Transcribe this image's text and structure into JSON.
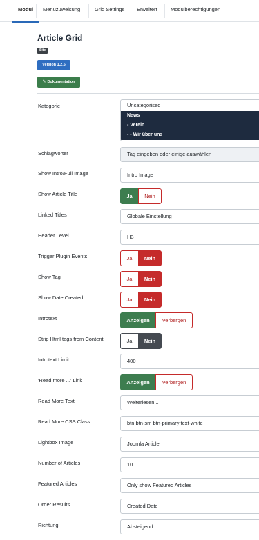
{
  "tabs": [
    "Modul",
    "Menüzuweisung",
    "Grid Settings",
    "Erweitert",
    "Modulberechtigungen"
  ],
  "header": {
    "title": "Article Grid",
    "site_badge": "Site",
    "version_button": "Version 1.2.6",
    "doc_button": "Dokumentation",
    "doc_icon": "edit-icon"
  },
  "category": {
    "label": "Kategorie",
    "top": "Uncategorised",
    "options": [
      "News",
      "- Verein",
      "- - Wir über uns"
    ]
  },
  "tags": {
    "label": "Schlagwörter",
    "placeholder": "Tag eingeben oder einige auswählen"
  },
  "intro_image": {
    "label": "Show Intro/Full Image",
    "value": "Intro Image"
  },
  "show_title": {
    "label": "Show Article Title",
    "yes": "Ja",
    "no": "Nein"
  },
  "linked_titles": {
    "label": "Linked Titles",
    "value": "Globale Einstellung"
  },
  "header_level": {
    "label": "Header Level",
    "value": "H3"
  },
  "trigger_events": {
    "label": "Trigger Plugin Events",
    "yes": "Ja",
    "no": "Nein"
  },
  "show_tag": {
    "label": "Show Tag",
    "yes": "Ja",
    "no": "Nein"
  },
  "show_date": {
    "label": "Show Date Created",
    "yes": "Ja",
    "no": "Nein"
  },
  "introtext": {
    "label": "Introtext",
    "show": "Anzeigen",
    "hide": "Verbergen"
  },
  "strip_html": {
    "label": "Strip Html tags from Content",
    "yes": "Ja",
    "no": "Nein"
  },
  "introtext_limit": {
    "label": "Introtext Limit",
    "value": "400"
  },
  "read_more_link": {
    "label": "'Read more ...' Link",
    "show": "Anzeigen",
    "hide": "Verbergen"
  },
  "read_more_text": {
    "label": "Read More Text",
    "value": "Weiterlesen..."
  },
  "read_more_css": {
    "label": "Read More CSS Class",
    "value": "btn btn-sm btn-primary text-white"
  },
  "lightbox": {
    "label": "Lightbox Image",
    "value": "Joomla Article"
  },
  "num_articles": {
    "label": "Number of Articles",
    "value": "10"
  },
  "featured": {
    "label": "Featured Articles",
    "value": "Only show Featured Articles"
  },
  "order": {
    "label": "Order Results",
    "value": "Created Date"
  },
  "direction": {
    "label": "Richtung",
    "value": "Absteigend"
  },
  "colors": {
    "tab_accent": "#2a69b8",
    "green": "#3d7d4f",
    "red": "#c52b2b",
    "dark": "#454a51",
    "navy": "#1e2b3f",
    "blue": "#2f6ec1"
  }
}
